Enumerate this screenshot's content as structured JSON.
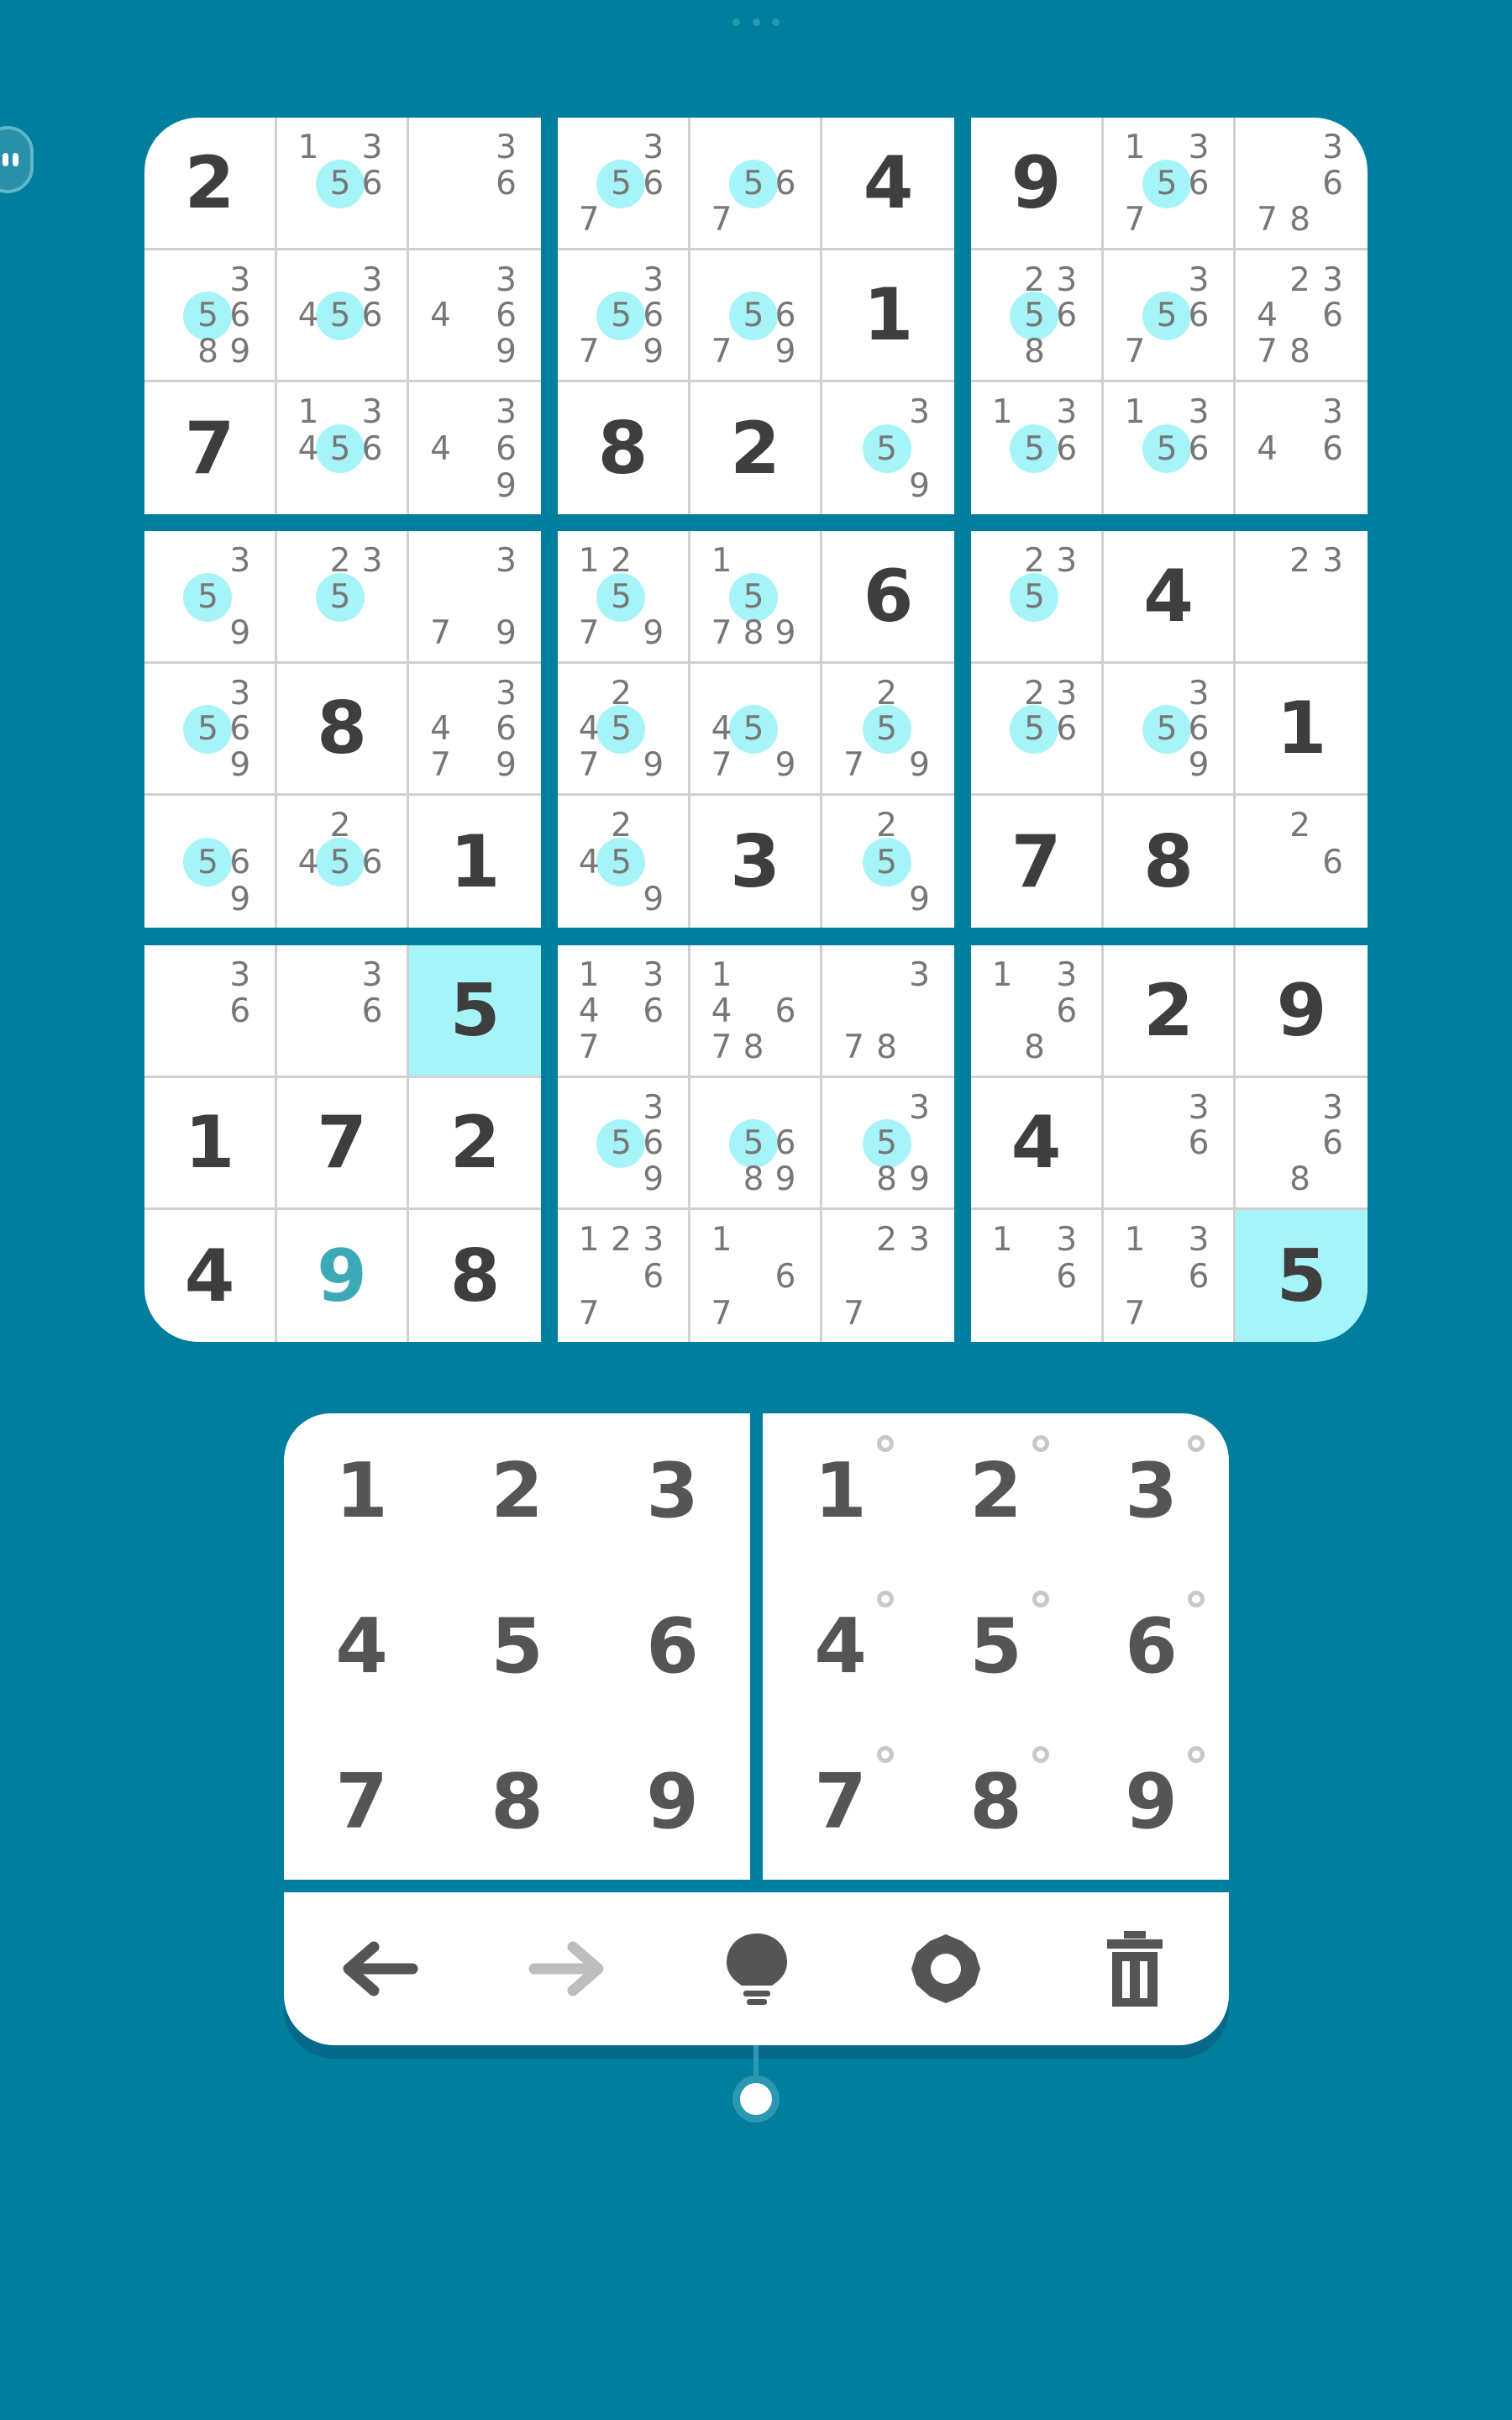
{
  "board": {
    "selected_value": "5",
    "highlight_color": "#A6F4F8",
    "cells": [
      [
        {
          "v": "2",
          "given": true
        },
        {
          "n": [
            "1",
            "3",
            "5",
            "6"
          ]
        },
        {
          "n": [
            "3",
            "6"
          ]
        },
        {
          "n": [
            "3",
            "5",
            "6",
            "7"
          ]
        },
        {
          "n": [
            "5",
            "6",
            "7"
          ]
        },
        {
          "v": "4",
          "given": true
        },
        {
          "v": "9",
          "given": true
        },
        {
          "n": [
            "1",
            "3",
            "5",
            "6",
            "7"
          ]
        },
        {
          "n": [
            "3",
            "6",
            "7",
            "8"
          ]
        }
      ],
      [
        {
          "n": [
            "3",
            "5",
            "6",
            "8",
            "9"
          ]
        },
        {
          "n": [
            "3",
            "4",
            "5",
            "6"
          ]
        },
        {
          "n": [
            "3",
            "4",
            "6",
            "9"
          ]
        },
        {
          "n": [
            "3",
            "5",
            "6",
            "7",
            "9"
          ]
        },
        {
          "n": [
            "5",
            "6",
            "7",
            "9"
          ]
        },
        {
          "v": "1",
          "given": true
        },
        {
          "n": [
            "2",
            "3",
            "5",
            "6",
            "8"
          ]
        },
        {
          "n": [
            "3",
            "5",
            "6",
            "7"
          ]
        },
        {
          "n": [
            "2",
            "3",
            "4",
            "6",
            "7",
            "8"
          ]
        }
      ],
      [
        {
          "v": "7",
          "given": true
        },
        {
          "n": [
            "1",
            "3",
            "4",
            "5",
            "6"
          ]
        },
        {
          "n": [
            "3",
            "4",
            "6",
            "9"
          ]
        },
        {
          "v": "8",
          "given": true
        },
        {
          "v": "2",
          "given": true
        },
        {
          "n": [
            "3",
            "5",
            "9"
          ]
        },
        {
          "n": [
            "1",
            "3",
            "5",
            "6"
          ]
        },
        {
          "n": [
            "1",
            "3",
            "5",
            "6"
          ]
        },
        {
          "n": [
            "3",
            "4",
            "6"
          ]
        }
      ],
      [
        {
          "n": [
            "3",
            "5",
            "9"
          ]
        },
        {
          "n": [
            "2",
            "3",
            "5"
          ]
        },
        {
          "n": [
            "3",
            "7",
            "9"
          ]
        },
        {
          "n": [
            "1",
            "2",
            "5",
            "7",
            "9"
          ]
        },
        {
          "n": [
            "1",
            "5",
            "7",
            "8",
            "9"
          ]
        },
        {
          "v": "6",
          "given": true
        },
        {
          "n": [
            "2",
            "3",
            "5"
          ]
        },
        {
          "v": "4",
          "given": true
        },
        {
          "n": [
            "2",
            "3"
          ]
        }
      ],
      [
        {
          "n": [
            "3",
            "5",
            "6",
            "9"
          ]
        },
        {
          "v": "8",
          "given": true
        },
        {
          "n": [
            "3",
            "4",
            "6",
            "7",
            "9"
          ]
        },
        {
          "n": [
            "2",
            "4",
            "5",
            "7",
            "9"
          ]
        },
        {
          "n": [
            "4",
            "5",
            "7",
            "9"
          ]
        },
        {
          "n": [
            "2",
            "5",
            "7",
            "9"
          ]
        },
        {
          "n": [
            "2",
            "3",
            "5",
            "6"
          ]
        },
        {
          "n": [
            "3",
            "5",
            "6",
            "9"
          ]
        },
        {
          "v": "1",
          "given": true
        }
      ],
      [
        {
          "n": [
            "5",
            "6",
            "9"
          ]
        },
        {
          "n": [
            "2",
            "4",
            "5",
            "6"
          ]
        },
        {
          "v": "1",
          "given": true
        },
        {
          "n": [
            "2",
            "4",
            "5",
            "9"
          ]
        },
        {
          "v": "3",
          "given": true
        },
        {
          "n": [
            "2",
            "5",
            "9"
          ]
        },
        {
          "v": "7",
          "given": true
        },
        {
          "v": "8",
          "given": true
        },
        {
          "n": [
            "2",
            "6"
          ]
        }
      ],
      [
        {
          "n": [
            "3",
            "6"
          ]
        },
        {
          "n": [
            "3",
            "6"
          ]
        },
        {
          "v": "5",
          "given": true,
          "sel": true
        },
        {
          "n": [
            "1",
            "3",
            "4",
            "6",
            "7"
          ]
        },
        {
          "n": [
            "1",
            "4",
            "6",
            "7",
            "8"
          ]
        },
        {
          "n": [
            "3",
            "7",
            "8"
          ]
        },
        {
          "n": [
            "1",
            "3",
            "6",
            "8"
          ]
        },
        {
          "v": "2",
          "given": true
        },
        {
          "v": "9",
          "given": true
        }
      ],
      [
        {
          "v": "1",
          "given": true
        },
        {
          "v": "7",
          "given": true
        },
        {
          "v": "2",
          "given": true
        },
        {
          "n": [
            "3",
            "5",
            "6",
            "9"
          ]
        },
        {
          "n": [
            "5",
            "6",
            "8",
            "9"
          ]
        },
        {
          "n": [
            "3",
            "5",
            "8",
            "9"
          ]
        },
        {
          "v": "4",
          "given": true
        },
        {
          "n": [
            "3",
            "6"
          ]
        },
        {
          "n": [
            "3",
            "6",
            "8"
          ]
        }
      ],
      [
        {
          "v": "4",
          "given": true
        },
        {
          "v": "9",
          "given": false
        },
        {
          "v": "8",
          "given": true
        },
        {
          "n": [
            "1",
            "2",
            "3",
            "6",
            "7"
          ]
        },
        {
          "n": [
            "1",
            "6",
            "7"
          ]
        },
        {
          "n": [
            "2",
            "3",
            "7"
          ]
        },
        {
          "n": [
            "1",
            "3",
            "6"
          ]
        },
        {
          "n": [
            "1",
            "3",
            "6",
            "7"
          ]
        },
        {
          "v": "5",
          "given": true,
          "sel": true
        }
      ]
    ]
  },
  "value_pad": [
    "1",
    "2",
    "3",
    "4",
    "5",
    "6",
    "7",
    "8",
    "9"
  ],
  "notes_pad": [
    "1",
    "2",
    "3",
    "4",
    "5",
    "6",
    "7",
    "8",
    "9"
  ],
  "toolbar": {
    "icons": [
      "undo-arrow-icon",
      "redo-arrow-icon",
      "hint-bulb-icon",
      "settings-gear-icon",
      "erase-trash-icon"
    ],
    "enabled_color": "#555555",
    "disabled_color": "#BDBDBD"
  }
}
